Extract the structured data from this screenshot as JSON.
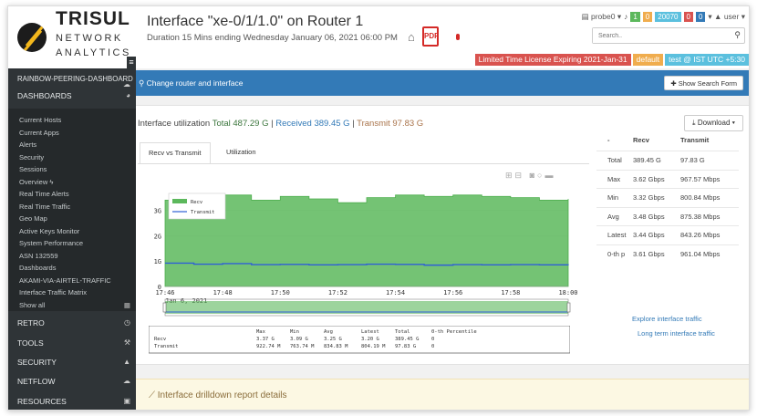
{
  "brand": {
    "line1": "TRISUL",
    "line2": "NETWORK",
    "line3": "ANALYTICS"
  },
  "sidebar": {
    "rainbow": "RAINBOW-PEERING-DASHBOARD",
    "dashboards": "DASHBOARDS",
    "items": [
      "Current Hosts",
      "Current Apps",
      "Alerts",
      "Security",
      "Sessions",
      "Overview",
      "Real Time Alerts",
      "Real Time Traffic",
      "Geo Map",
      "Active Keys Monitor",
      "System Performance",
      "ASN 132559",
      "Dashboards",
      "AKAMI-VIA-AIRTEL-TRAFFIC",
      "Interface Traffic Matrix",
      "Show all"
    ],
    "sections": [
      "RETRO",
      "TOOLS",
      "SECURITY",
      "NETFLOW",
      "RESOURCES"
    ]
  },
  "header": {
    "title": "Interface \"xe-0/1/1.0\" on Router 1",
    "subtitle": "Duration 15 Mins ending Wednesday January 06, 2021 06:00 PM",
    "user_probe": "probe0",
    "badges": [
      {
        "text": "1",
        "color": "#5cb85c"
      },
      {
        "text": "0",
        "color": "#f0ad4e"
      },
      {
        "text": "20070",
        "color": "#5bc0de"
      },
      {
        "text": "0",
        "color": "#d9534f"
      },
      {
        "text": "0",
        "color": "#337ab7"
      }
    ],
    "user": "user",
    "search_placeholder": "Search..",
    "license": "Limited Time License Expiring 2021-Jan-31",
    "default_label": "default",
    "tz_label": "test @ IST UTC +5:30"
  },
  "main": {
    "change_label": "Change router and interface",
    "show_search": "Show Search Form",
    "util_title": "Interface utilization",
    "total": "Total 487.29 G",
    "received": "Received 389.45 G",
    "transmit": "Transmit 97.83 G",
    "download": "Download",
    "tabs": [
      "Recv vs Transmit",
      "Utilization"
    ],
    "explore": "Explore interface traffic",
    "long_term": "Long term interface traffic",
    "drilldown": "Interface drilldown report details"
  },
  "stats_table": {
    "headers": [
      "-",
      "Recv",
      "Transmit"
    ],
    "rows": [
      [
        "Total",
        "389.45 G",
        "97.83 G"
      ],
      [
        "Max",
        "3.62 Gbps",
        "967.57 Mbps"
      ],
      [
        "Min",
        "3.32 Gbps",
        "800.84 Mbps"
      ],
      [
        "Avg",
        "3.48 Gbps",
        "875.38 Mbps"
      ],
      [
        "Latest",
        "3.44 Gbps",
        "843.26 Mbps"
      ],
      [
        "0-th p",
        "3.61 Gbps",
        "961.04 Mbps"
      ]
    ]
  },
  "summary_table": {
    "headers": [
      "",
      "Max",
      "Min",
      "Avg",
      "Latest",
      "Total",
      "0-th Percentile"
    ],
    "rows": [
      [
        "Recv",
        "3.37 G",
        "3.09 G",
        "3.25 G",
        "3.20 G",
        "389.45 G",
        "0"
      ],
      [
        "Transmit",
        "922.74 M",
        "763.74 M",
        "834.83 M",
        "804.19 M",
        "97.83 G",
        "0"
      ]
    ]
  },
  "chart_data": {
    "type": "area",
    "x": [
      "17:46",
      "17:48",
      "17:50",
      "17:52",
      "17:54",
      "17:56",
      "17:58",
      "18:00"
    ],
    "xsub": "Jan 6, 2021",
    "ytick_labels": [
      "0",
      "1G",
      "2G",
      "3G"
    ],
    "ylim": [
      0,
      4
    ],
    "series": [
      {
        "name": "Recv",
        "color": "#5cb85c",
        "values": [
          3.4,
          3.45,
          3.6,
          3.4,
          3.55,
          3.45,
          3.3,
          3.5,
          3.6,
          3.55,
          3.6,
          3.55,
          3.5,
          3.4,
          3.45
        ]
      },
      {
        "name": "Transmit",
        "color": "#2e5fd6",
        "values": [
          0.92,
          0.88,
          0.9,
          0.86,
          0.87,
          0.85,
          0.86,
          0.88,
          0.87,
          0.84,
          0.86,
          0.85,
          0.86,
          0.85,
          0.84
        ]
      }
    ]
  },
  "colors": {
    "recv": "#337ab7",
    "transmit": "#a9734a",
    "green": "#5cb85c",
    "blue_bar": "#337ab7"
  }
}
